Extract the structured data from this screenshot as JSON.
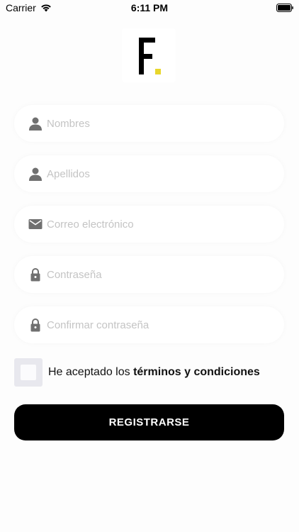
{
  "status_bar": {
    "carrier": "Carrier",
    "time": "6:11 PM",
    "wifi_icon": "wifi-icon",
    "battery_icon": "battery-icon"
  },
  "logo": {
    "letter": "F",
    "accent_color": "#e8d62c"
  },
  "form": {
    "fields": [
      {
        "placeholder": "Nombres",
        "value": "",
        "icon": "person-icon"
      },
      {
        "placeholder": "Apellidos",
        "value": "",
        "icon": "person-icon"
      },
      {
        "placeholder": "Correo electrónico",
        "value": "",
        "icon": "mail-icon"
      },
      {
        "placeholder": "Contraseña",
        "value": "",
        "icon": "lock-icon"
      },
      {
        "placeholder": "Confirmar contraseña",
        "value": "",
        "icon": "lock-icon"
      }
    ],
    "terms_prefix": "He aceptado los ",
    "terms_link": "términos y condiciones",
    "terms_checked": false,
    "submit_label": "REGISTRARSE"
  },
  "colors": {
    "background": "#fdfdfd",
    "button": "#000000",
    "icon": "#707070",
    "placeholder": "#c4c4c4"
  }
}
